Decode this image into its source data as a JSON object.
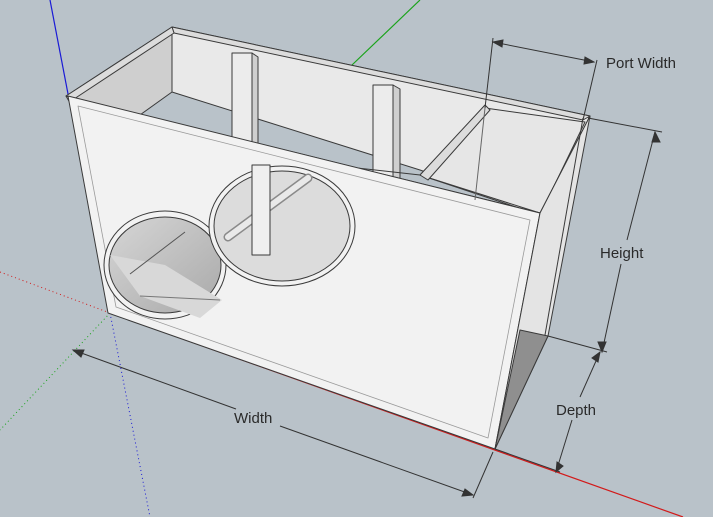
{
  "model": {
    "subject": "subwoofer enclosure with two driver cutouts and a slot port",
    "colors": {
      "background": "#b9c2c9",
      "front_face": "#f2f2f2",
      "side_face": "#e4e4e4",
      "edge_line": "#3a3a3a",
      "axis_red": "#d21a1a",
      "axis_green": "#1aa31a",
      "axis_blue": "#1a1ad6"
    }
  },
  "dimensions": {
    "width_label": "Width",
    "height_label": "Height",
    "depth_label": "Depth",
    "port_width_label": "Port Width"
  }
}
